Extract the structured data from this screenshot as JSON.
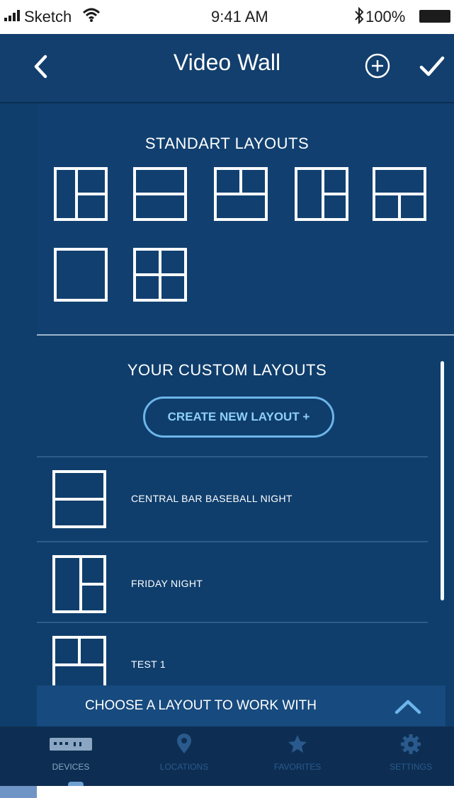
{
  "status_bar": {
    "carrier": "Sketch",
    "time": "9:41 AM",
    "battery": "100%"
  },
  "nav": {
    "title": "Video Wall"
  },
  "standard": {
    "title": "STANDART LAYOUTS"
  },
  "custom": {
    "title": "YOUR CUSTOM LAYOUTS",
    "create_label": "CREATE NEW LAYOUT +",
    "items": [
      {
        "label": "CENTRAL BAR BASEBALL NIGHT",
        "icon": "layout-split-horizontal-icon"
      },
      {
        "label": "FRIDAY NIGHT",
        "icon": "layout-left-right-split-icon"
      },
      {
        "label": "TEST 1",
        "icon": "layout-top-split-icon"
      }
    ]
  },
  "bottom_bar": {
    "label": "CHOOSE A LAYOUT TO WORK WITH"
  },
  "tabs": [
    {
      "label": "DEVICES",
      "icon": "devices-icon",
      "active": true
    },
    {
      "label": "LOCATIONS",
      "icon": "location-pin-icon",
      "active": false
    },
    {
      "label": "FAVORITES",
      "icon": "star-icon",
      "active": false
    },
    {
      "label": "SETTINGS",
      "icon": "gear-icon",
      "active": false
    }
  ],
  "colors": {
    "background": "#0f3e6c",
    "accent": "#6db5ea",
    "tabbar": "#0d2e52"
  }
}
